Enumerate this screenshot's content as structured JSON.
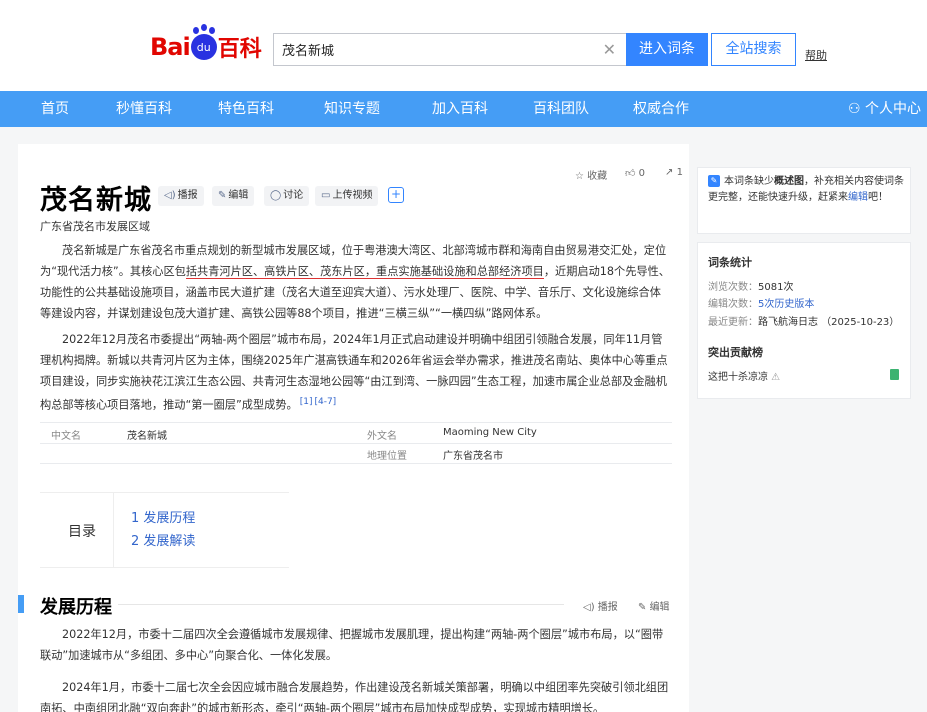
{
  "header": {
    "logo": {
      "bai": "Bai",
      "du": "du",
      "ke": "百科"
    },
    "search_value": "茂名新城",
    "enter_button": "进入词条",
    "all_search_button": "全站搜索",
    "help": "帮助"
  },
  "nav": {
    "items": [
      "首页",
      "秒懂百科",
      "特色百科",
      "知识专题",
      "加入百科",
      "百科团队",
      "权威合作"
    ],
    "user_center": "个人中心"
  },
  "entry": {
    "title": "茂名新城",
    "tools": [
      "播报",
      "编辑",
      "讨论",
      "上传视频"
    ],
    "subtitle": "广东省茂名市发展区域",
    "collect_label": "收藏",
    "like_count": "0",
    "share_count": "1",
    "paragraphs": {
      "p1_a": "茂名新城是广东省茂名市重点规划的新型城市发展区域，位于粤港澳大湾区、北部湾城市群和海南自由贸易港交汇处，定位为“现代活力核”。其核心区包",
      "p1_ul": "括共青河片区、高铁片区、茂东片区，重点实施基础设施和总部经济项目",
      "p1_b": "，近期启动18个先导性、功能性的公共基础设施项目，涵盖市民大道扩建（茂名大道至迎宾大道）、污水处理厂、医院、中学、音乐厅、文化设施综合体等建设内容，并谋划建设包茂大道扩建、高铁公园等88个项目，推进“三横三纵”“一横四纵”路网体系。",
      "p2": "2022年12月茂名市委提出“两轴-两个圈层”城市布局，2024年1月正式启动建设并明确中组团引领融合发展，同年11月管理机构揭牌。新城以共青河片区为主体，围绕2025年广湛高铁通车和2026年省运会举办需求，推进茂名南站、奥体中心等重点项目建设，同步实施袂花江滨江生态公园、共青河生态湿地公园等“由江到湾、一脉四园”生态工程，加速市属企业总部及金融机构总部等核心项目落地，推动“第一圈层”成型成势。",
      "p2_ref1": "[1]",
      "p2_ref2": "[4-7]"
    },
    "infobox": [
      {
        "key": "中文名",
        "value": "茂名新城"
      },
      {
        "key": "外文名",
        "value": "Maoming New City"
      },
      {
        "key": "地理位置",
        "value": "广东省茂名市"
      }
    ],
    "toc": {
      "label": "目录",
      "items": [
        "1 发展历程",
        "2 发展解读"
      ]
    },
    "section": {
      "title": "发展历程",
      "actions": [
        "播报",
        "编辑"
      ],
      "p1": "2022年12月，市委十二届四次全会遵循城市发展规律、把握城市发展肌理，提出构建“两轴-两个圈层”城市布局，以“圈带联动”加速城市从“多组团、多中心”向聚合化、一体化发展。",
      "p2": "2024年1月，市委十二届七次全会因应城市融合发展趋势，作出建设茂名新城关策部署，明确以中组团率先突破引领北组团南拓、中南组团北融“双向奔赴”的城市新形态，牵引“两轴-两个圈层”城市布局加快成型成势，实现城市精明增长。"
    }
  },
  "sidebar": {
    "notice_a": "本词条缺少",
    "notice_bold": "概述图",
    "notice_b": "，补充相关内容使词条更完整，还能快速升级，赶紧来",
    "notice_link": "编辑",
    "notice_c": "吧！",
    "stats_title": "词条统计",
    "views_label": "浏览次数：",
    "views_value": "5081次",
    "edits_label": "编辑次数：",
    "edits_value": "5次历史版本",
    "updated_label": "最近更新：",
    "updated_value": "路飞航海日志 （2025-10-23）",
    "contrib_title": "突出贡献榜",
    "contrib_user": "这把十杀凉凉"
  },
  "colors": {
    "brand_blue": "#459df5",
    "button_blue": "#3385ff",
    "underline_red": "#dd3333"
  }
}
